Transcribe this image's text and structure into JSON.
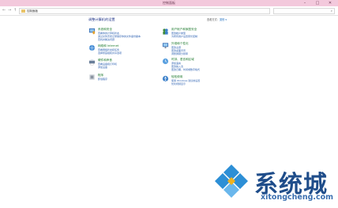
{
  "window": {
    "title": "控制面板"
  },
  "address": {
    "crumb": "控制面板"
  },
  "main": {
    "heading": "调整计算机的设置",
    "view_by_label": "查看方式：",
    "view_by_value": "类别 ▾"
  },
  "categories": [
    {
      "title": "系统和安全",
      "links": [
        "查看你的计算机状态",
        "通过文件历史记录保存你的文件备份副本",
        "查找并解决问题"
      ]
    },
    {
      "title": "网络和 Internet",
      "links": [
        "查看网络状态和任务",
        "选择家庭组和共享选项"
      ]
    },
    {
      "title": "硬件和声音",
      "links": [
        "查看设备和打印机",
        "添加设备"
      ]
    },
    {
      "title": "程序",
      "links": [
        "卸载程序"
      ]
    },
    {
      "title": "用户帐户和家庭安全",
      "links": [
        "更改帐户类型",
        "为所有用户设置家长控制"
      ]
    },
    {
      "title": "外观和个性化",
      "links": [
        "更改主题",
        "更改桌面背景",
        "调整屏幕分辨率"
      ]
    },
    {
      "title": "时钟、语言和区域",
      "links": [
        "添加语言",
        "更改输入法",
        "更改日期、时间或数字格式"
      ]
    },
    {
      "title": "轻松使用",
      "links": [
        "使用 Windows 建议的设置",
        "优化视频显示"
      ]
    }
  ],
  "watermark": {
    "brand": "系统城",
    "url": "xitongcheng.com",
    "color": "#1f6fbf"
  }
}
